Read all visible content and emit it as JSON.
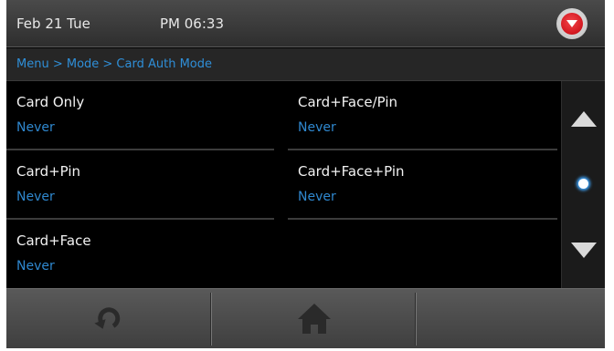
{
  "status": {
    "date": "Feb 21 Tue",
    "time": "PM 06:33",
    "alert_icon": "alert-dropdown-icon",
    "alert_color": "#d51a22"
  },
  "breadcrumb": "Menu > Mode > Card Auth Mode",
  "accent_color": "#2f88cf",
  "items": [
    {
      "title": "Card Only",
      "value": "Never"
    },
    {
      "title": "Card+Pin",
      "value": "Never"
    },
    {
      "title": "Card+Face",
      "value": "Never"
    },
    {
      "title": "Card+Face/Pin",
      "value": "Never"
    },
    {
      "title": "Card+Face+Pin",
      "value": "Never"
    }
  ],
  "scroll": {
    "up_icon": "arrow-up-icon",
    "down_icon": "arrow-down-icon",
    "page_indicator_icon": "page-dot-icon"
  },
  "toolbar": {
    "buttons": [
      {
        "icon": "refresh-icon"
      },
      {
        "icon": "home-icon"
      },
      {
        "icon": ""
      }
    ]
  }
}
